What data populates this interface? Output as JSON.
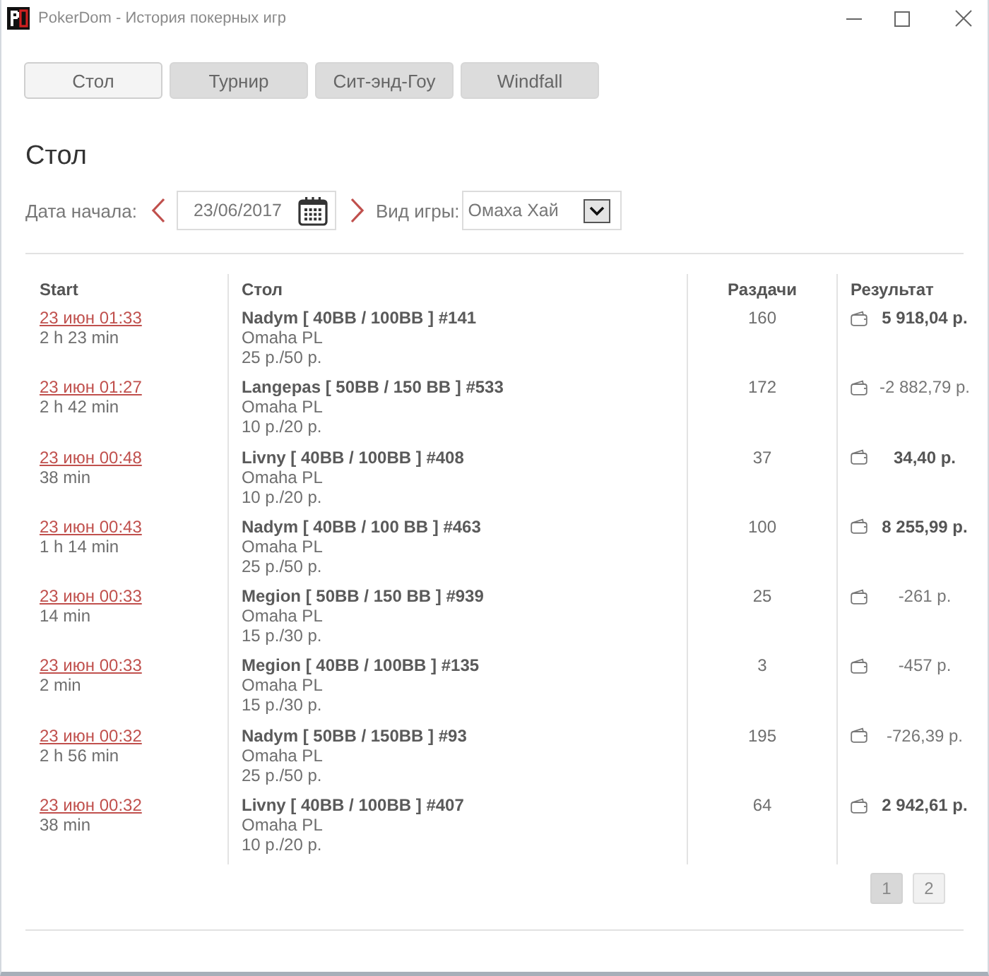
{
  "window": {
    "title": "PokerDom - История покерных игр"
  },
  "tabs": [
    {
      "label": "Стол",
      "selected": true
    },
    {
      "label": "Турнир",
      "selected": false
    },
    {
      "label": "Сит-энд-Гоу",
      "selected": false
    },
    {
      "label": "Windfall",
      "selected": false
    }
  ],
  "heading": "Стол",
  "filters": {
    "date_label": "Дата начала:",
    "date": {
      "value": "23/06/2017"
    },
    "game_label": "Вид игры:",
    "game": {
      "value": "Омаха Хай"
    }
  },
  "table": {
    "columns": [
      "Start",
      "Стол",
      "Раздачи",
      "Результат"
    ],
    "rows": [
      {
        "start": "23 июн 01:33",
        "duration": "2 h 23 min",
        "table": "Nadym [ 40BB / 100BB ] #141",
        "game": "Omaha PL",
        "stakes": "25 р./50 р.",
        "hands": "160",
        "result": "5 918,04 р.",
        "win": true
      },
      {
        "start": "23 июн 01:27",
        "duration": "2 h 42 min",
        "table": "Langepas [ 50BB / 150 BB ] #533",
        "game": "Omaha PL",
        "stakes": "10 р./20 р.",
        "hands": "172",
        "result": "-2 882,79 р.",
        "win": false
      },
      {
        "start": "23 июн 00:48",
        "duration": "38 min",
        "table": "Livny [ 40BB / 100BB ] #408",
        "game": "Omaha PL",
        "stakes": "10 р./20 р.",
        "hands": "37",
        "result": "34,40 р.",
        "win": true
      },
      {
        "start": "23 июн 00:43",
        "duration": "1 h 14 min",
        "table": "Nadym [ 40BB / 100 BB ] #463",
        "game": "Omaha PL",
        "stakes": "25 р./50 р.",
        "hands": "100",
        "result": "8 255,99 р.",
        "win": true
      },
      {
        "start": "23 июн 00:33",
        "duration": "14 min",
        "table": "Megion [ 50BB / 150 BB ] #939",
        "game": "Omaha PL",
        "stakes": "15 р./30 р.",
        "hands": "25",
        "result": "-261 р.",
        "win": false
      },
      {
        "start": "23 июн 00:33",
        "duration": "2 min",
        "table": "Megion [ 40BB / 100BB ] #135",
        "game": "Omaha PL",
        "stakes": "15 р./30 р.",
        "hands": "3",
        "result": "-457 р.",
        "win": false
      },
      {
        "start": "23 июн 00:32",
        "duration": "2 h 56 min",
        "table": "Nadym [ 50BB / 150BB ] #93",
        "game": "Omaha PL",
        "stakes": "25 р./50 р.",
        "hands": "195",
        "result": "-726,39 р.",
        "win": false
      },
      {
        "start": "23 июн 00:32",
        "duration": "38 min",
        "table": "Livny [ 40BB / 100BB ] #407",
        "game": "Omaha PL",
        "stakes": "10 р./20 р.",
        "hands": "64",
        "result": "2 942,61 р.",
        "win": true
      }
    ]
  },
  "pagination": [
    {
      "label": "1",
      "selected": true
    },
    {
      "label": "2",
      "selected": false
    }
  ]
}
